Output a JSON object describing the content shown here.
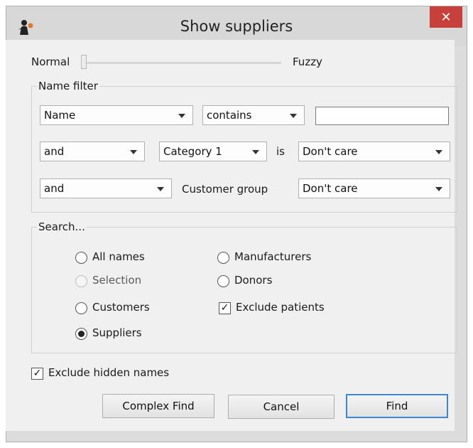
{
  "window": {
    "title": "Show suppliers",
    "close_glyph": "✕"
  },
  "fuzzy": {
    "left_label": "Normal",
    "right_label": "Fuzzy",
    "level": 0
  },
  "name_filter": {
    "title": "Name filter",
    "row1": {
      "field": "Name",
      "operator": "contains",
      "value": ""
    },
    "row2": {
      "conjunction": "and",
      "category": "Category 1",
      "is_label": "is",
      "value": "Don't care"
    },
    "row3": {
      "conjunction": "and",
      "label": "Customer group",
      "value": "Don't care"
    }
  },
  "search": {
    "title": "Search...",
    "options": {
      "all_names": {
        "label": "All names",
        "selected": false
      },
      "selection": {
        "label": "Selection",
        "selected": false,
        "disabled": true
      },
      "customers": {
        "label": "Customers",
        "selected": false
      },
      "suppliers": {
        "label": "Suppliers",
        "selected": true
      },
      "manufacturers": {
        "label": "Manufacturers",
        "selected": false
      },
      "donors": {
        "label": "Donors",
        "selected": false
      }
    },
    "exclude_patients": {
      "label": "Exclude patients",
      "checked": true,
      "mark": "✓"
    }
  },
  "exclude_hidden": {
    "label": "Exclude hidden names",
    "checked": true,
    "mark": "✓"
  },
  "buttons": {
    "complex_find": "Complex Find",
    "cancel": "Cancel",
    "find": "Find"
  },
  "colors": {
    "close_button": "#c7413a",
    "default_button_border": "#3c86d4"
  },
  "icons": {
    "app": "person-icon",
    "close": "close-icon"
  }
}
